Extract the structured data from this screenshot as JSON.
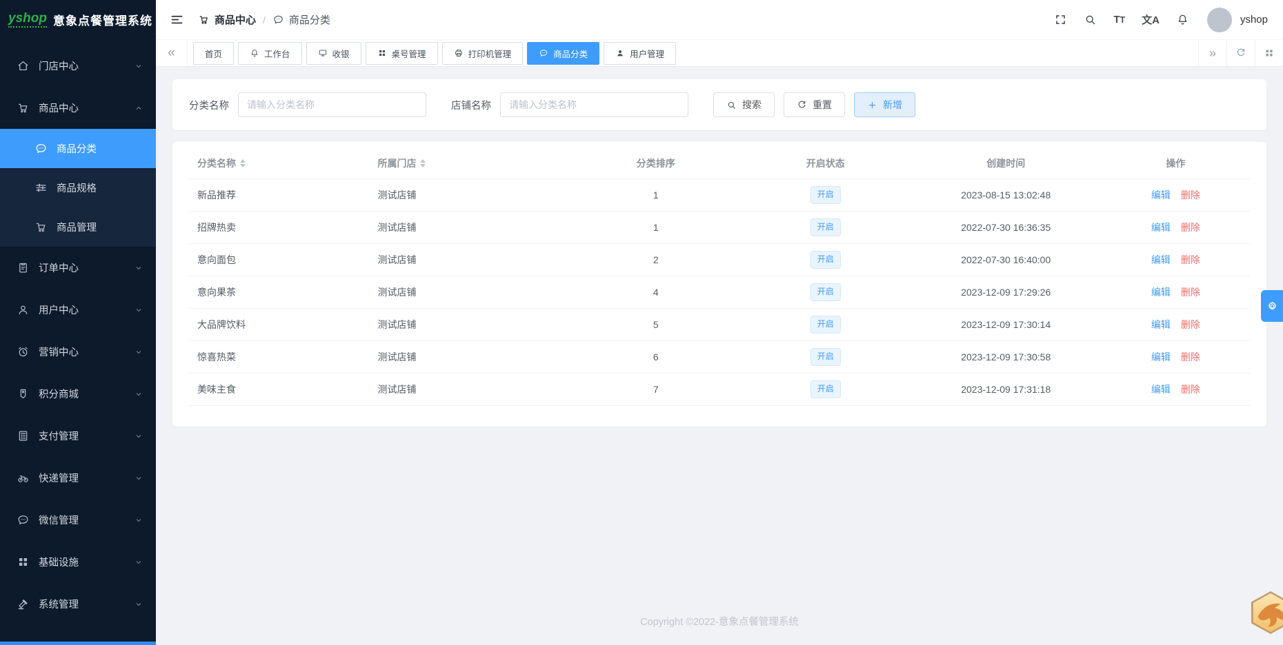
{
  "colors": {
    "accent": "#3e9cfc",
    "sidebar_bg": "#0c1a2c",
    "submenu_bg": "#16263c",
    "danger": "#f56c6c",
    "badge_bg": "#e9f4fe",
    "logo_green": "#2fae4c",
    "content_bg": "#f0f2f5"
  },
  "app": {
    "logo_text": "yshop",
    "title": "意象点餐管理系统",
    "username": "yshop"
  },
  "breadcrumb": {
    "parent_icon": "cart",
    "parent_label": "商品中心",
    "separator": "/",
    "current_icon": "chat",
    "current_label": "商品分类"
  },
  "sidebar": {
    "items": [
      {
        "key": "store-center",
        "label": "门店中心",
        "icon": "house",
        "expandable": true,
        "expanded": false
      },
      {
        "key": "product-center",
        "label": "商品中心",
        "icon": "cart",
        "expandable": true,
        "expanded": true,
        "children": [
          {
            "key": "product-category",
            "label": "商品分类",
            "icon": "chat",
            "active": true
          },
          {
            "key": "product-spec",
            "label": "商品规格",
            "icon": "sliders",
            "active": false
          },
          {
            "key": "product-manage",
            "label": "商品管理",
            "icon": "cart",
            "active": false
          }
        ]
      },
      {
        "key": "order-center",
        "label": "订单中心",
        "icon": "clipboard",
        "expandable": true,
        "expanded": false
      },
      {
        "key": "user-center",
        "label": "用户中心",
        "icon": "user",
        "expandable": true,
        "expanded": false
      },
      {
        "key": "marketing-center",
        "label": "营销中心",
        "icon": "alarm",
        "expandable": true,
        "expanded": false
      },
      {
        "key": "points-mall",
        "label": "积分商城",
        "icon": "tag",
        "expandable": true,
        "expanded": false
      },
      {
        "key": "payment-manage",
        "label": "支付管理",
        "icon": "calculator",
        "expandable": true,
        "expanded": false
      },
      {
        "key": "express-manage",
        "label": "快递管理",
        "icon": "bike",
        "expandable": true,
        "expanded": false
      },
      {
        "key": "wechat-manage",
        "label": "微信管理",
        "icon": "chat",
        "expandable": true,
        "expanded": false
      },
      {
        "key": "infrastructure",
        "label": "基础设施",
        "icon": "grid",
        "expandable": true,
        "expanded": false
      },
      {
        "key": "system-manage",
        "label": "系统管理",
        "icon": "hammer",
        "expandable": true,
        "expanded": false
      }
    ]
  },
  "tabbar": {
    "tabs": [
      {
        "key": "home",
        "label": "首页",
        "icon": null,
        "active": false
      },
      {
        "key": "workbench",
        "label": "工作台",
        "icon": "bell",
        "active": false
      },
      {
        "key": "cashier",
        "label": "收银",
        "icon": "monitor",
        "active": false
      },
      {
        "key": "table-manage",
        "label": "桌号管理",
        "icon": "grid",
        "active": false
      },
      {
        "key": "printer-manage",
        "label": "打印机管理",
        "icon": "printer",
        "active": false
      },
      {
        "key": "product-category",
        "label": "商品分类",
        "icon": "chat",
        "active": true
      },
      {
        "key": "user-manage",
        "label": "用户管理",
        "icon": "user-solid",
        "active": false
      }
    ]
  },
  "filters": {
    "fields": [
      {
        "label": "分类名称",
        "placeholder": "请输入分类名称",
        "value": ""
      },
      {
        "label": "店铺名称",
        "placeholder": "请输入分类名称",
        "value": ""
      }
    ],
    "search_label": "搜索",
    "reset_label": "重置",
    "add_label": "新增"
  },
  "table": {
    "columns": [
      {
        "label": "分类名称",
        "sortable": true
      },
      {
        "label": "所属门店",
        "sortable": true
      },
      {
        "label": "分类排序",
        "sortable": false
      },
      {
        "label": "开启状态",
        "sortable": false
      },
      {
        "label": "创建时间",
        "sortable": false
      },
      {
        "label": "操作",
        "sortable": false
      }
    ],
    "rows": [
      {
        "name": "新品推荐",
        "shop": "测试店铺",
        "sort": "1",
        "status": "开启",
        "created": "2023-08-15 13:02:48"
      },
      {
        "name": "招牌热卖",
        "shop": "测试店铺",
        "sort": "1",
        "status": "开启",
        "created": "2022-07-30 16:36:35"
      },
      {
        "name": "意向面包",
        "shop": "测试店铺",
        "sort": "2",
        "status": "开启",
        "created": "2022-07-30 16:40:00"
      },
      {
        "name": "意向果茶",
        "shop": "测试店铺",
        "sort": "4",
        "status": "开启",
        "created": "2023-12-09 17:29:26"
      },
      {
        "name": "大品牌饮料",
        "shop": "测试店铺",
        "sort": "5",
        "status": "开启",
        "created": "2023-12-09 17:30:14"
      },
      {
        "name": "惊喜热菜",
        "shop": "测试店铺",
        "sort": "6",
        "status": "开启",
        "created": "2023-12-09 17:30:58"
      },
      {
        "name": "美味主食",
        "shop": "测试店铺",
        "sort": "7",
        "status": "开启",
        "created": "2023-12-09 17:31:18"
      }
    ],
    "edit_label": "编辑",
    "delete_label": "删除"
  },
  "footer": {
    "copyright": "Copyright ©2022-意象点餐管理系统"
  }
}
